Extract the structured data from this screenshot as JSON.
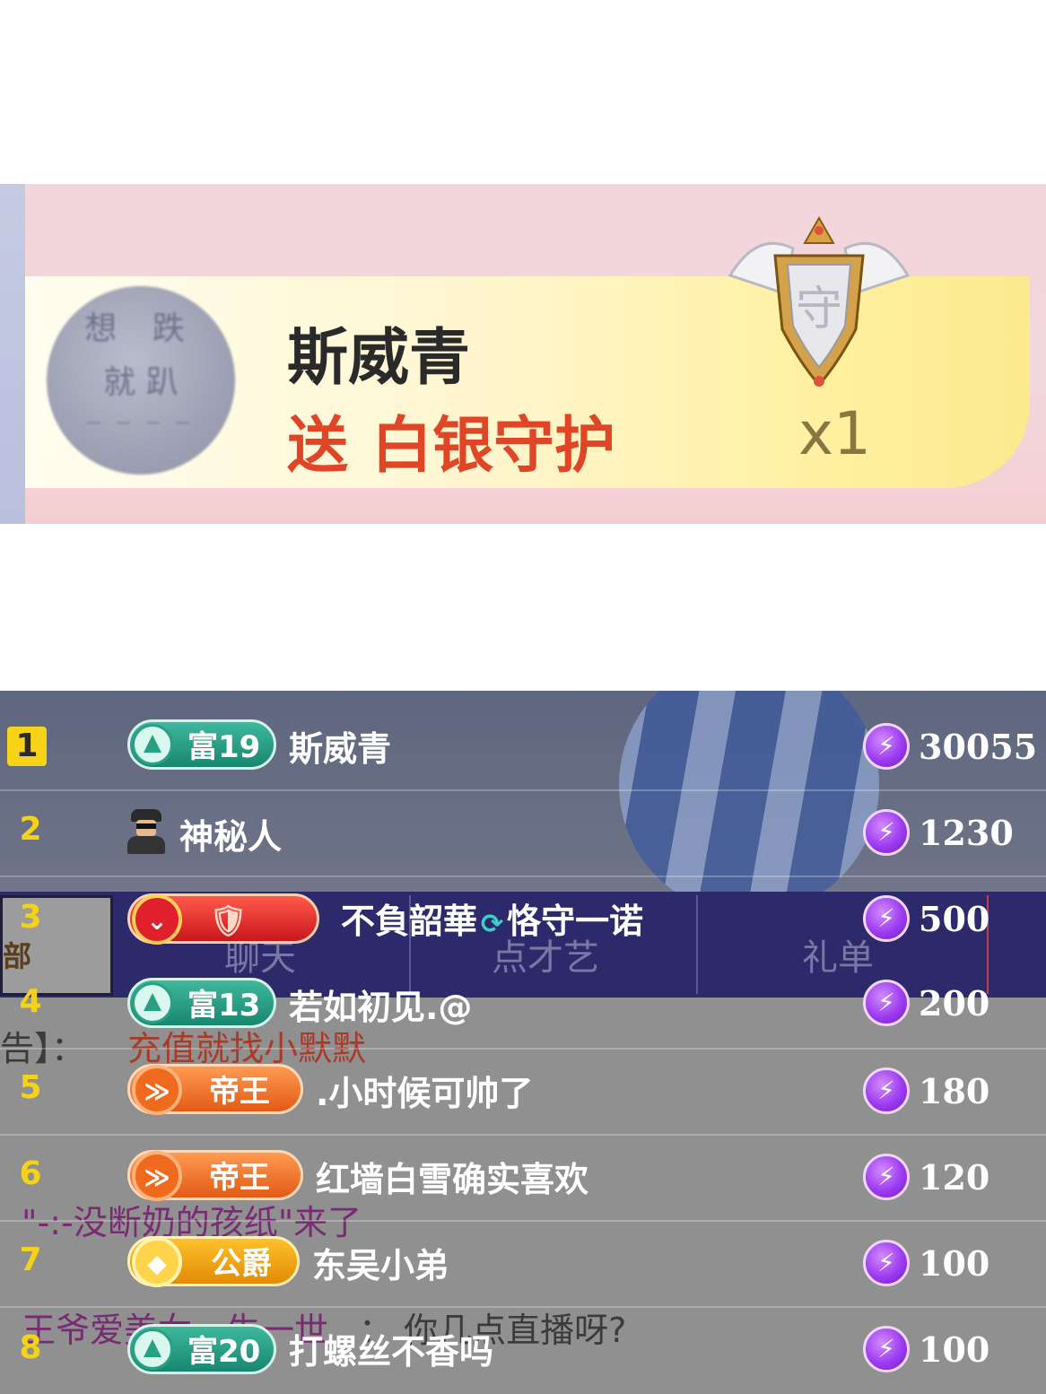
{
  "gift_banner": {
    "avatar_text": [
      "想 跌",
      "就 趴",
      "— — — —"
    ],
    "sender_name": "斯威青",
    "action": "送",
    "gift_name": "白银守护",
    "count": "x1",
    "shield_glyph": "守",
    "colors": {
      "gift_text": "#e04526",
      "name_text": "#2a2a2a"
    }
  },
  "chat_overlay": {
    "left_tab_fragment": "部",
    "tabs": [
      "聊天",
      "点才艺",
      "礼单"
    ],
    "ghost_lines": {
      "notice_prefix": "告】：",
      "notice_text": "充值就找小默默",
      "enter_message": "\"-:-没断奶的孩纸\"来了",
      "chat_user": "王爷爱美女一生一世",
      "chat_message": "： 你几点直播呀?"
    }
  },
  "leaderboard": {
    "rows": [
      {
        "rank": "1",
        "badge_type": "rich",
        "badge_label": "富19",
        "name": "斯威青",
        "score": "30055"
      },
      {
        "rank": "2",
        "badge_type": "mystery",
        "badge_label": "",
        "name": "神秘人",
        "score": "1230"
      },
      {
        "rank": "3",
        "badge_type": "guard",
        "badge_label": "🛡",
        "name": "不負韶華",
        "name_extra": "恪守一诺",
        "score": "500"
      },
      {
        "rank": "4",
        "badge_type": "rich",
        "badge_label": "富13",
        "name": "若如初见.@",
        "score": "200"
      },
      {
        "rank": "5",
        "badge_type": "king",
        "badge_label": "帝王",
        "name": ".小时候可帅了",
        "score": "180"
      },
      {
        "rank": "6",
        "badge_type": "king",
        "badge_label": "帝王",
        "name": "红墙白雪确实喜欢",
        "score": "120"
      },
      {
        "rank": "7",
        "badge_type": "duke",
        "badge_label": "公爵",
        "name": "东吴小弟",
        "score": "100"
      },
      {
        "rank": "8",
        "badge_type": "rich",
        "badge_label": "富20",
        "name": "打螺丝不香吗",
        "score": "100"
      }
    ],
    "icons": {
      "score": "lightning-coin-icon",
      "mystery": "spy-icon"
    }
  }
}
